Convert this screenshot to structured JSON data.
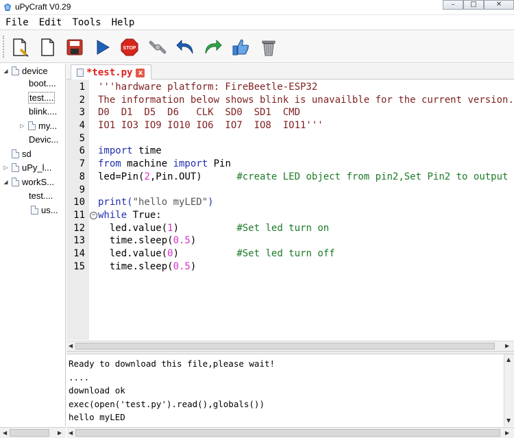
{
  "window": {
    "title": "uPyCraft V0.29",
    "minimize": "–",
    "maximize": "□",
    "close": "✕"
  },
  "menu": [
    "File",
    "Edit",
    "Tools",
    "Help"
  ],
  "toolbar": {
    "buttons": [
      {
        "name": "new-file",
        "icon": "new-file-icon"
      },
      {
        "name": "open-file",
        "icon": "open-file-icon"
      },
      {
        "name": "save-file",
        "icon": "save-icon"
      },
      {
        "name": "download-and-run",
        "icon": "play-icon"
      },
      {
        "name": "stop",
        "icon": "stop-icon",
        "label": "STOP"
      },
      {
        "name": "connect",
        "icon": "connect-icon"
      },
      {
        "name": "undo",
        "icon": "undo-icon"
      },
      {
        "name": "redo",
        "icon": "redo-icon"
      },
      {
        "name": "syntax-check",
        "icon": "thumbs-up-icon"
      },
      {
        "name": "clear",
        "icon": "trash-icon"
      }
    ]
  },
  "tree": {
    "items": [
      {
        "label": "device",
        "expanded": true
      },
      {
        "label": "boot...."
      },
      {
        "label": "test....",
        "selected": true
      },
      {
        "label": "blink...."
      },
      {
        "label": "my..."
      },
      {
        "label": "Devic..."
      },
      {
        "label": "sd"
      },
      {
        "label": "uPy_l..."
      },
      {
        "label": "workS...",
        "expanded": true
      },
      {
        "label": "test...."
      },
      {
        "label": "us..."
      }
    ]
  },
  "tab": {
    "label": "*test.py",
    "close": "x"
  },
  "editor": {
    "line_numbers": [
      "1",
      "2",
      "3",
      "4",
      "5",
      "6",
      "7",
      "8",
      "9",
      "10",
      "11",
      "12",
      "13",
      "14",
      "15"
    ],
    "lines": {
      "l1": "'''hardware platform: FireBeetle-ESP32",
      "l2": "The information below shows blink is unavailble for the current version.",
      "l3": "D0  D1  D5  D6   CLK  SD0  SD1  CMD",
      "l4": "IO1 IO3 IO9 IO10 IO6  IO7  IO8  IO11'''",
      "l6_kw": "import",
      "l6_rest": " time",
      "l7_kw1": "from",
      "l7_mid": " machine ",
      "l7_kw2": "import",
      "l7_rest": " Pin",
      "l8_a": "led=Pin(",
      "l8_num": "2",
      "l8_b": ",Pin.OUT)",
      "l8_pad": "      ",
      "l8_cmt": "#create LED object from pin2,Set Pin2 to output",
      "l10_a": "print(",
      "l10_str": "\"hello myLED\"",
      "l10_b": ")",
      "l11_kw": "while",
      "l11_rest": " True:",
      "l12_a": "  led.value(",
      "l12_num": "1",
      "l12_b": ")",
      "l12_pad": "          ",
      "l12_cmt": "#Set led turn on",
      "l13_a": "  time.sleep(",
      "l13_num": "0.5",
      "l13_b": ")",
      "l14_a": "  led.value(",
      "l14_num": "0",
      "l14_b": ")",
      "l14_pad": "          ",
      "l14_cmt": "#Set led turn off",
      "l15_a": "  time.sleep(",
      "l15_num": "0.5",
      "l15_b": ")"
    }
  },
  "console": {
    "lines": [
      "Ready to download this file,please wait!",
      "....",
      "download ok",
      "exec(open('test.py').read(),globals())",
      "hello myLED"
    ]
  },
  "colors": {
    "docstring": "#7f1f1f",
    "keyword": "#1f2fb0",
    "number": "#d52fc6",
    "comment": "#1c7a28",
    "tab_label": "#e02020"
  }
}
